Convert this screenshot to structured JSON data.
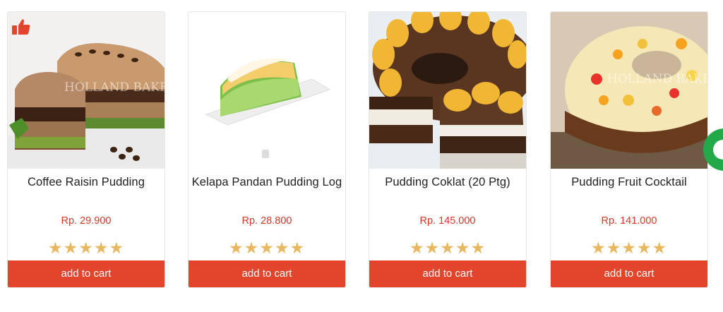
{
  "products": [
    {
      "name": "Coffee Raisin Pudding",
      "price": "Rp. 29.900",
      "rating": 5,
      "cta": "add to cart",
      "image": "coffee-raisin-pudding"
    },
    {
      "name": "Kelapa Pandan Pudding Log",
      "price": "Rp. 28.800",
      "rating": 5,
      "cta": "add to cart",
      "image": "kelapa-pandan-pudding-log"
    },
    {
      "name": "Pudding Coklat (20 Ptg)",
      "price": "Rp. 145.000",
      "rating": 5,
      "cta": "add to cart",
      "image": "pudding-coklat"
    },
    {
      "name": "Pudding Fruit Cocktail",
      "price": "Rp. 141.000",
      "rating": 5,
      "cta": "add to cart",
      "image": "pudding-fruit-cocktail"
    }
  ],
  "icons": {
    "badge": "thumbs-up-icon",
    "chat": "chat-icon",
    "star": "star-icon"
  },
  "watermark": "HOLLAND BAKERY",
  "colors": {
    "accent": "#e2452b",
    "price": "#d63a25",
    "star": "#e8b75f",
    "chat": "#23a84a"
  }
}
